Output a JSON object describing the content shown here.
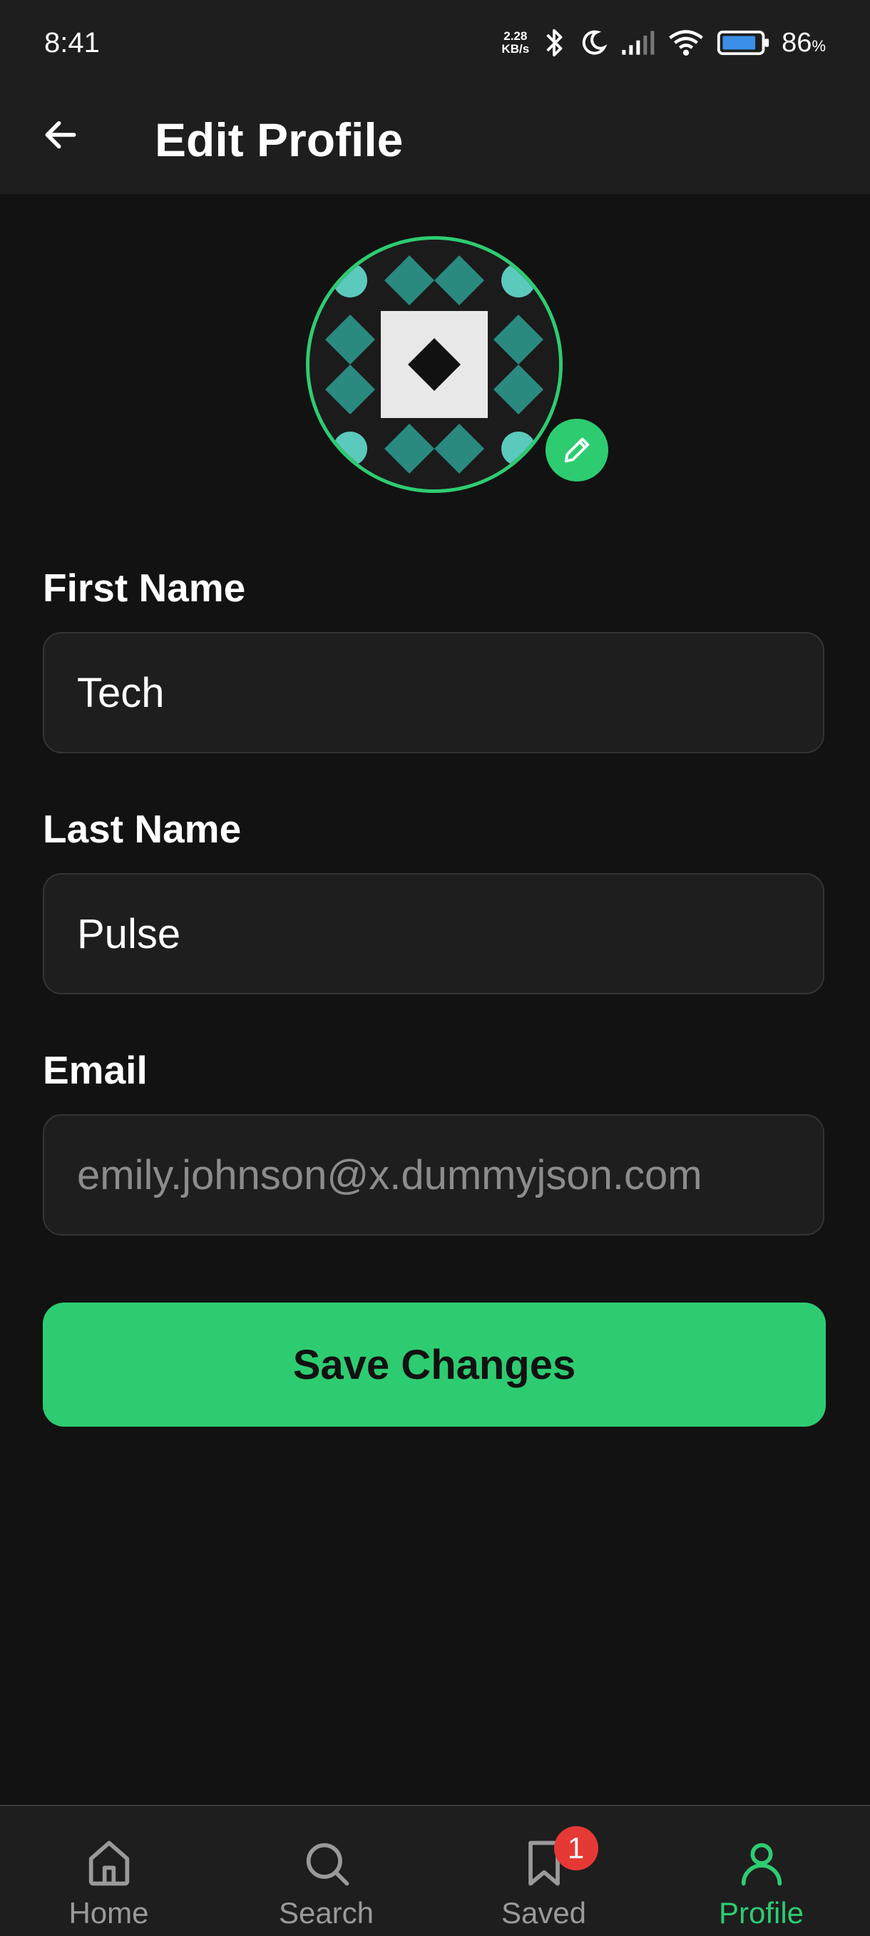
{
  "status_bar": {
    "time": "8:41",
    "net_speed_value": "2.28",
    "net_speed_unit": "KB/s",
    "battery_percent": "86",
    "battery_suffix": "%",
    "icons": [
      "bluetooth-icon",
      "moon-icon",
      "signal-icon",
      "wifi-icon",
      "battery-icon"
    ]
  },
  "header": {
    "title": "Edit Profile",
    "back_icon": "arrow-left-icon"
  },
  "avatar": {
    "edit_icon": "pencil-icon"
  },
  "form": {
    "first_name": {
      "label": "First Name",
      "value": "Tech"
    },
    "last_name": {
      "label": "Last Name",
      "value": "Pulse"
    },
    "email": {
      "label": "Email",
      "placeholder": "emily.johnson@x.dummyjson.com"
    },
    "save_label": "Save Changes"
  },
  "bottom_nav": {
    "items": [
      {
        "label": "Home",
        "icon": "home-icon"
      },
      {
        "label": "Search",
        "icon": "search-icon"
      },
      {
        "label": "Saved",
        "icon": "bookmark-icon",
        "badge": "1"
      },
      {
        "label": "Profile",
        "icon": "user-icon",
        "active": true
      }
    ]
  },
  "colors": {
    "accent": "#2ecc71",
    "background": "#121212",
    "surface": "#1e1e1e",
    "badge": "#e53935"
  }
}
